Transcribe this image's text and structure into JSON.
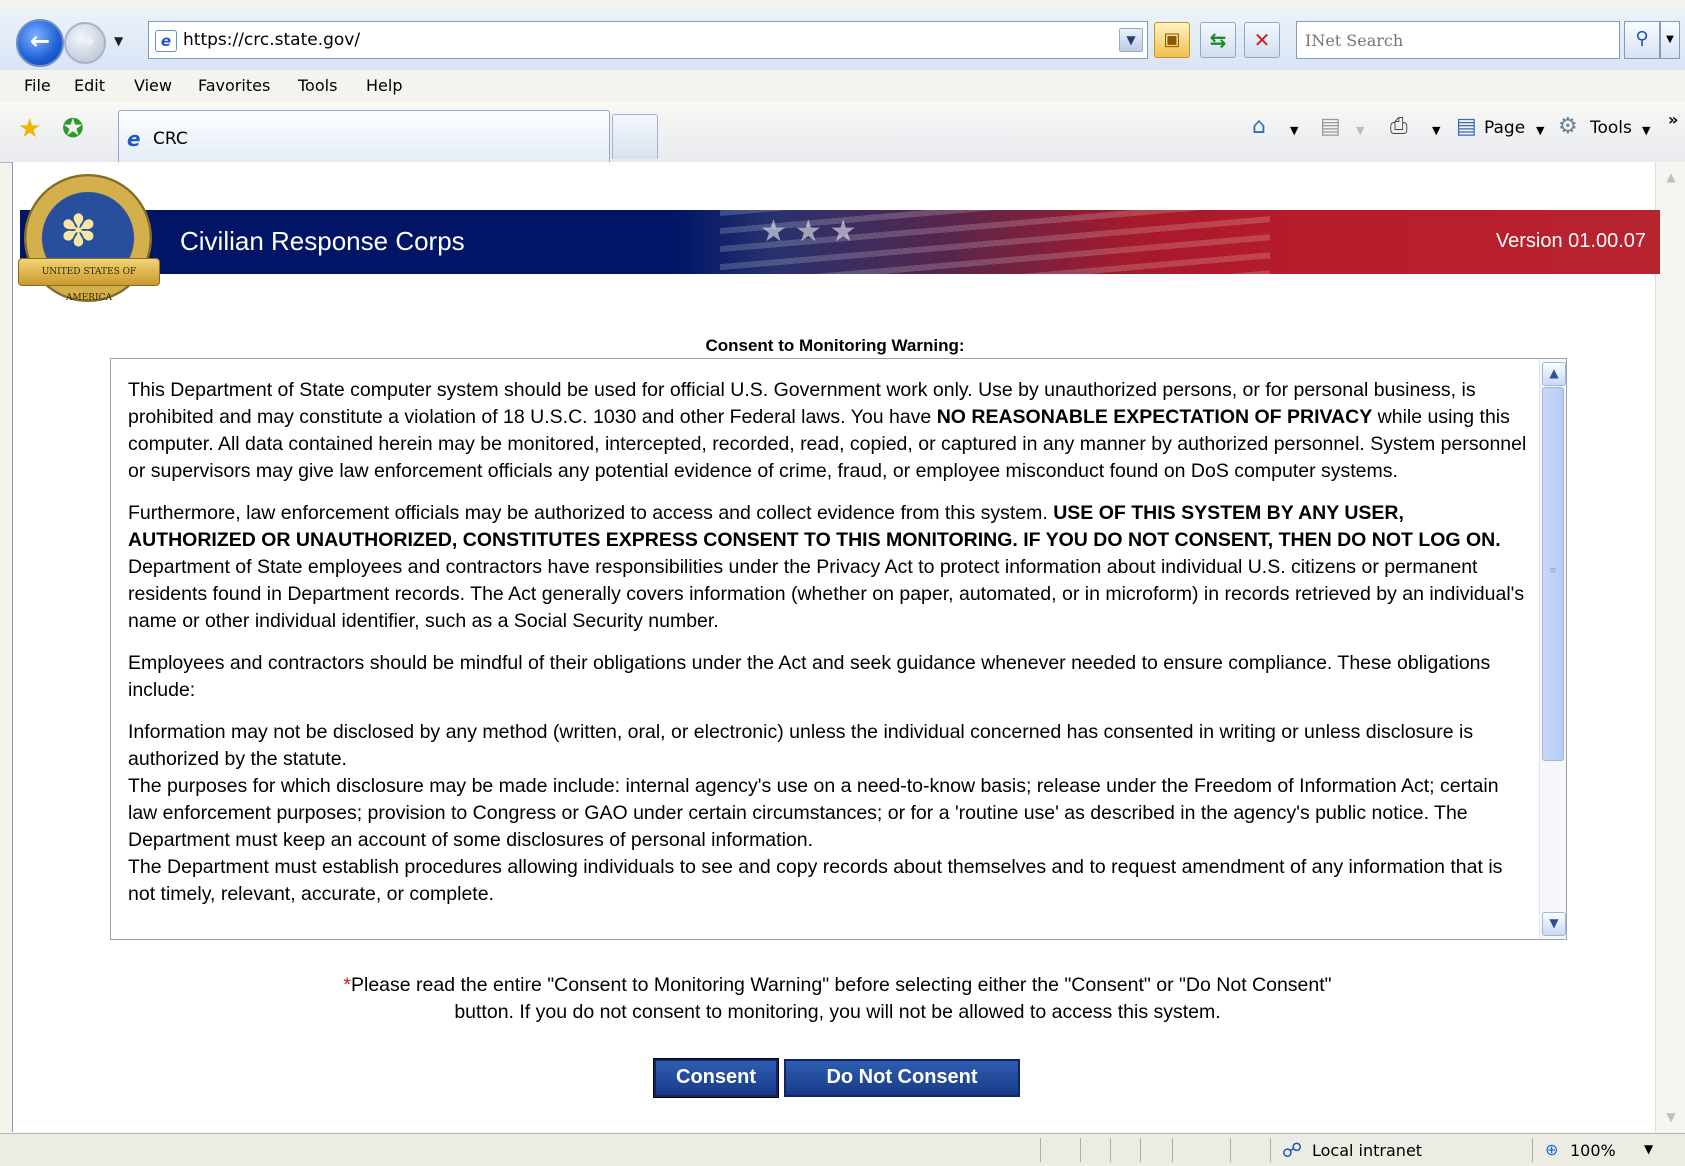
{
  "browser": {
    "url": "https://crc.state.gov/",
    "search_placeholder": "INet Search",
    "menu": [
      "File",
      "Edit",
      "View",
      "Favorites",
      "Tools",
      "Help"
    ],
    "tab_title": "CRC",
    "commands": {
      "page": "Page",
      "tools": "Tools"
    },
    "chevron": "»",
    "status": {
      "zone": "Local intranet",
      "zoom": "100%"
    }
  },
  "banner": {
    "title": "Civilian Response Corps",
    "version": "Version 01.00.07",
    "seal_ribbon": "UNITED STATES OF AMERICA"
  },
  "warning": {
    "title": "Consent to Monitoring Warning:",
    "p1": {
      "a": "This Department of State computer system should be used for official U.S. Government work only. Use by unauthorized persons, or for personal business, is prohibited and may constitute a violation of 18 U.S.C. 1030 and other Federal laws. You have ",
      "bold": "NO REASONABLE EXPECTATION OF PRIVACY",
      "b": " while using this computer. All data contained herein may be monitored, intercepted, recorded, read, copied, or captured in any manner by authorized personnel. System personnel or supervisors may give law enforcement officials any potential evidence of crime, fraud, or employee misconduct found on DoS computer systems."
    },
    "p2": {
      "a": "Furthermore, law enforcement officials may be authorized to access and collect evidence from this system. ",
      "bold": "USE OF THIS SYSTEM BY ANY USER, AUTHORIZED OR UNAUTHORIZED, CONSTITUTES EXPRESS CONSENT TO THIS MONITORING. IF YOU DO NOT CONSENT, THEN DO NOT LOG ON.",
      "b": " Department of State employees and contractors have responsibilities under the Privacy Act to protect information about individual U.S. citizens or permanent residents found in Department records. The Act generally covers information (whether on paper, automated, or in microform) in records retrieved by an individual's name or other individual identifier, such as a Social Security number."
    },
    "p3": "Employees and contractors should be mindful of their obligations under the Act and seek guidance whenever needed to ensure compliance. These obligations include:",
    "p4": "Information may not be disclosed by any method (written, oral, or electronic) unless the individual concerned has consented in writing or unless disclosure is authorized by the statute.",
    "p5": "The purposes for which disclosure may be made include: internal agency's use on a need-to-know basis; release under the Freedom of Information Act; certain law enforcement purposes; provision to Congress or GAO under certain circumstances; or for a 'routine use' as described in the agency's public notice. The Department must keep an account of some disclosures of personal information.",
    "p6": "The Department must establish procedures allowing individuals to see and copy records about themselves and to request amendment of any information that is not timely, relevant, accurate, or complete."
  },
  "notice": {
    "asterisk": "*",
    "line1": "Please read the entire \"Consent to Monitoring Warning\" before selecting either the \"Consent\" or \"Do Not Consent\"",
    "line2": "button. If you do not consent to monitoring, you will not be allowed to access this system."
  },
  "buttons": {
    "consent": "Consent",
    "do_not_consent": "Do Not Consent"
  }
}
